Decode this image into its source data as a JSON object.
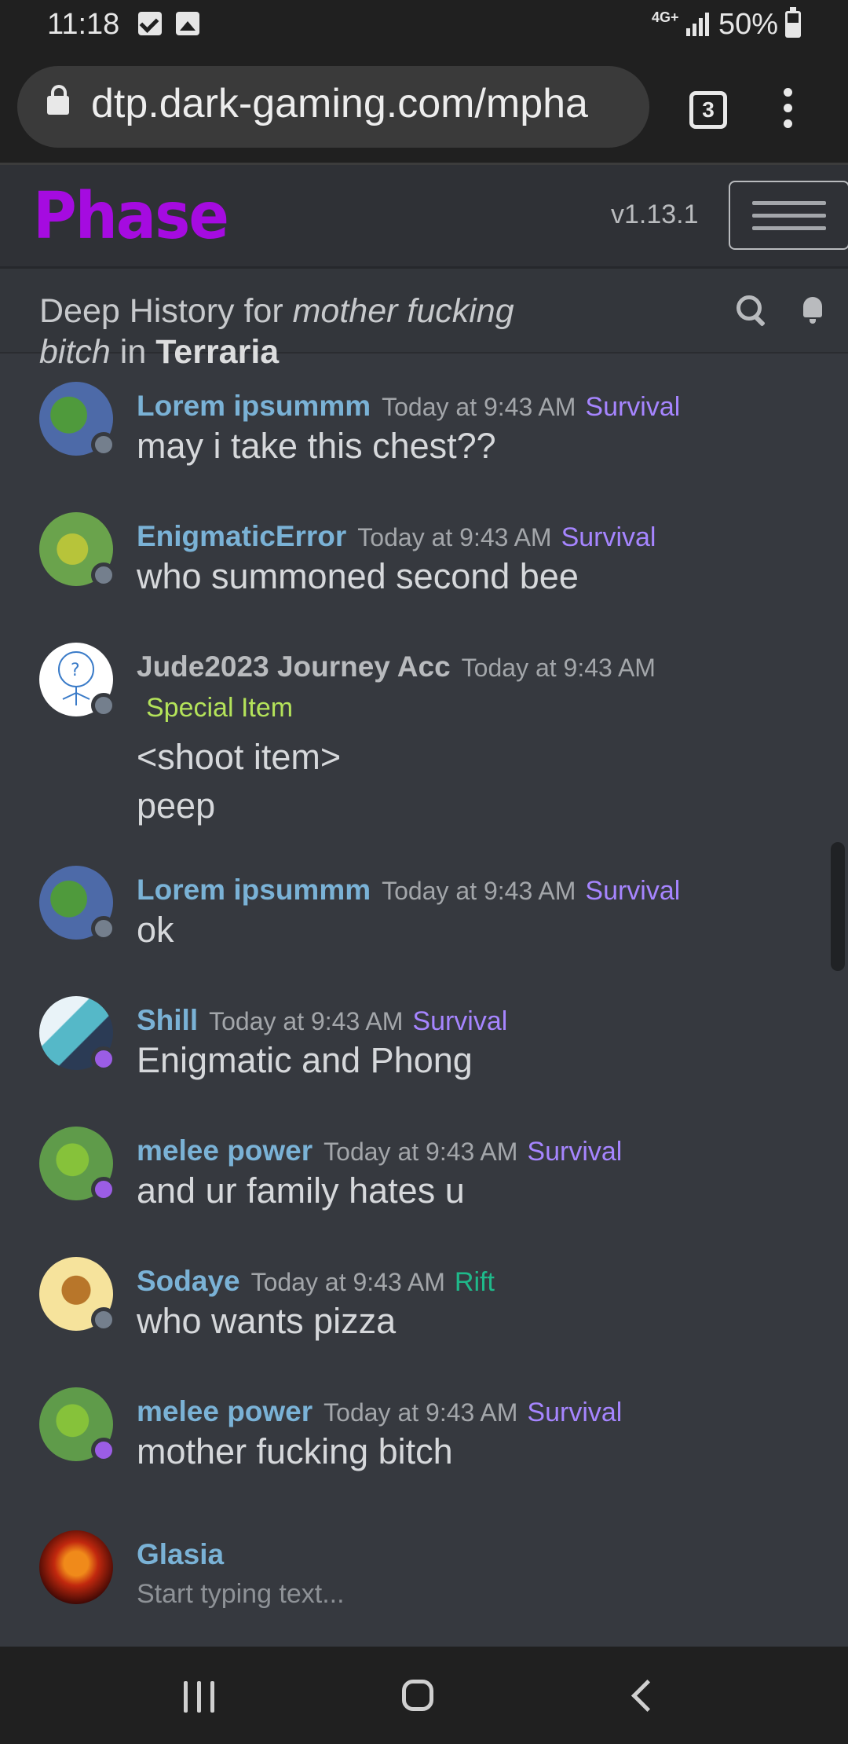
{
  "status_bar": {
    "time": "11:18",
    "network": "4G+",
    "battery": "50%"
  },
  "browser": {
    "url": "dtp.dark-gaming.com/mpha",
    "tab_count": "3"
  },
  "app": {
    "brand": "Phase",
    "version": "v1.13.1"
  },
  "header": {
    "prefix": "Deep History for ",
    "query": "mother fucking bitch",
    "joiner": " in ",
    "game": "Terraria"
  },
  "messages": [
    {
      "user": "Lorem ipsummm",
      "time": "Today at 9:43 AM",
      "tag": "Survival",
      "lines": [
        "may i take this chest??"
      ],
      "presence": "offline"
    },
    {
      "user": "EnigmaticError",
      "time": "Today at 9:43 AM",
      "tag": "Survival",
      "lines": [
        "who summoned second bee"
      ],
      "presence": "offline"
    },
    {
      "user": "Jude2023 Journey Acc",
      "time": "Today at 9:43 AM",
      "tag": "Special Item",
      "lines": [
        "<shoot item>",
        "peep"
      ],
      "presence": "offline"
    },
    {
      "user": "Lorem ipsummm",
      "time": "Today at 9:43 AM",
      "tag": "Survival",
      "lines": [
        "ok"
      ],
      "presence": "offline"
    },
    {
      "user": "Shill",
      "time": "Today at 9:43 AM",
      "tag": "Survival",
      "lines": [
        "Enigmatic and Phong"
      ],
      "presence": "online"
    },
    {
      "user": "melee power",
      "time": "Today at 9:43 AM",
      "tag": "Survival",
      "lines": [
        "and ur family hates u"
      ],
      "presence": "online"
    },
    {
      "user": "Sodaye",
      "time": "Today at 9:43 AM",
      "tag": "Rift",
      "lines": [
        "who wants pizza"
      ],
      "presence": "offline"
    },
    {
      "user": "melee power",
      "time": "Today at 9:43 AM",
      "tag": "Survival",
      "lines": [
        "mother fucking bitch"
      ],
      "presence": "online"
    }
  ],
  "composer": {
    "user": "Glasia",
    "placeholder": "Start typing text..."
  },
  "colors": {
    "brand": "#a50be0",
    "username": "#7ab2d6",
    "survival": "#a685ff",
    "rift": "#1fb98a",
    "special": "#b4e35a"
  }
}
